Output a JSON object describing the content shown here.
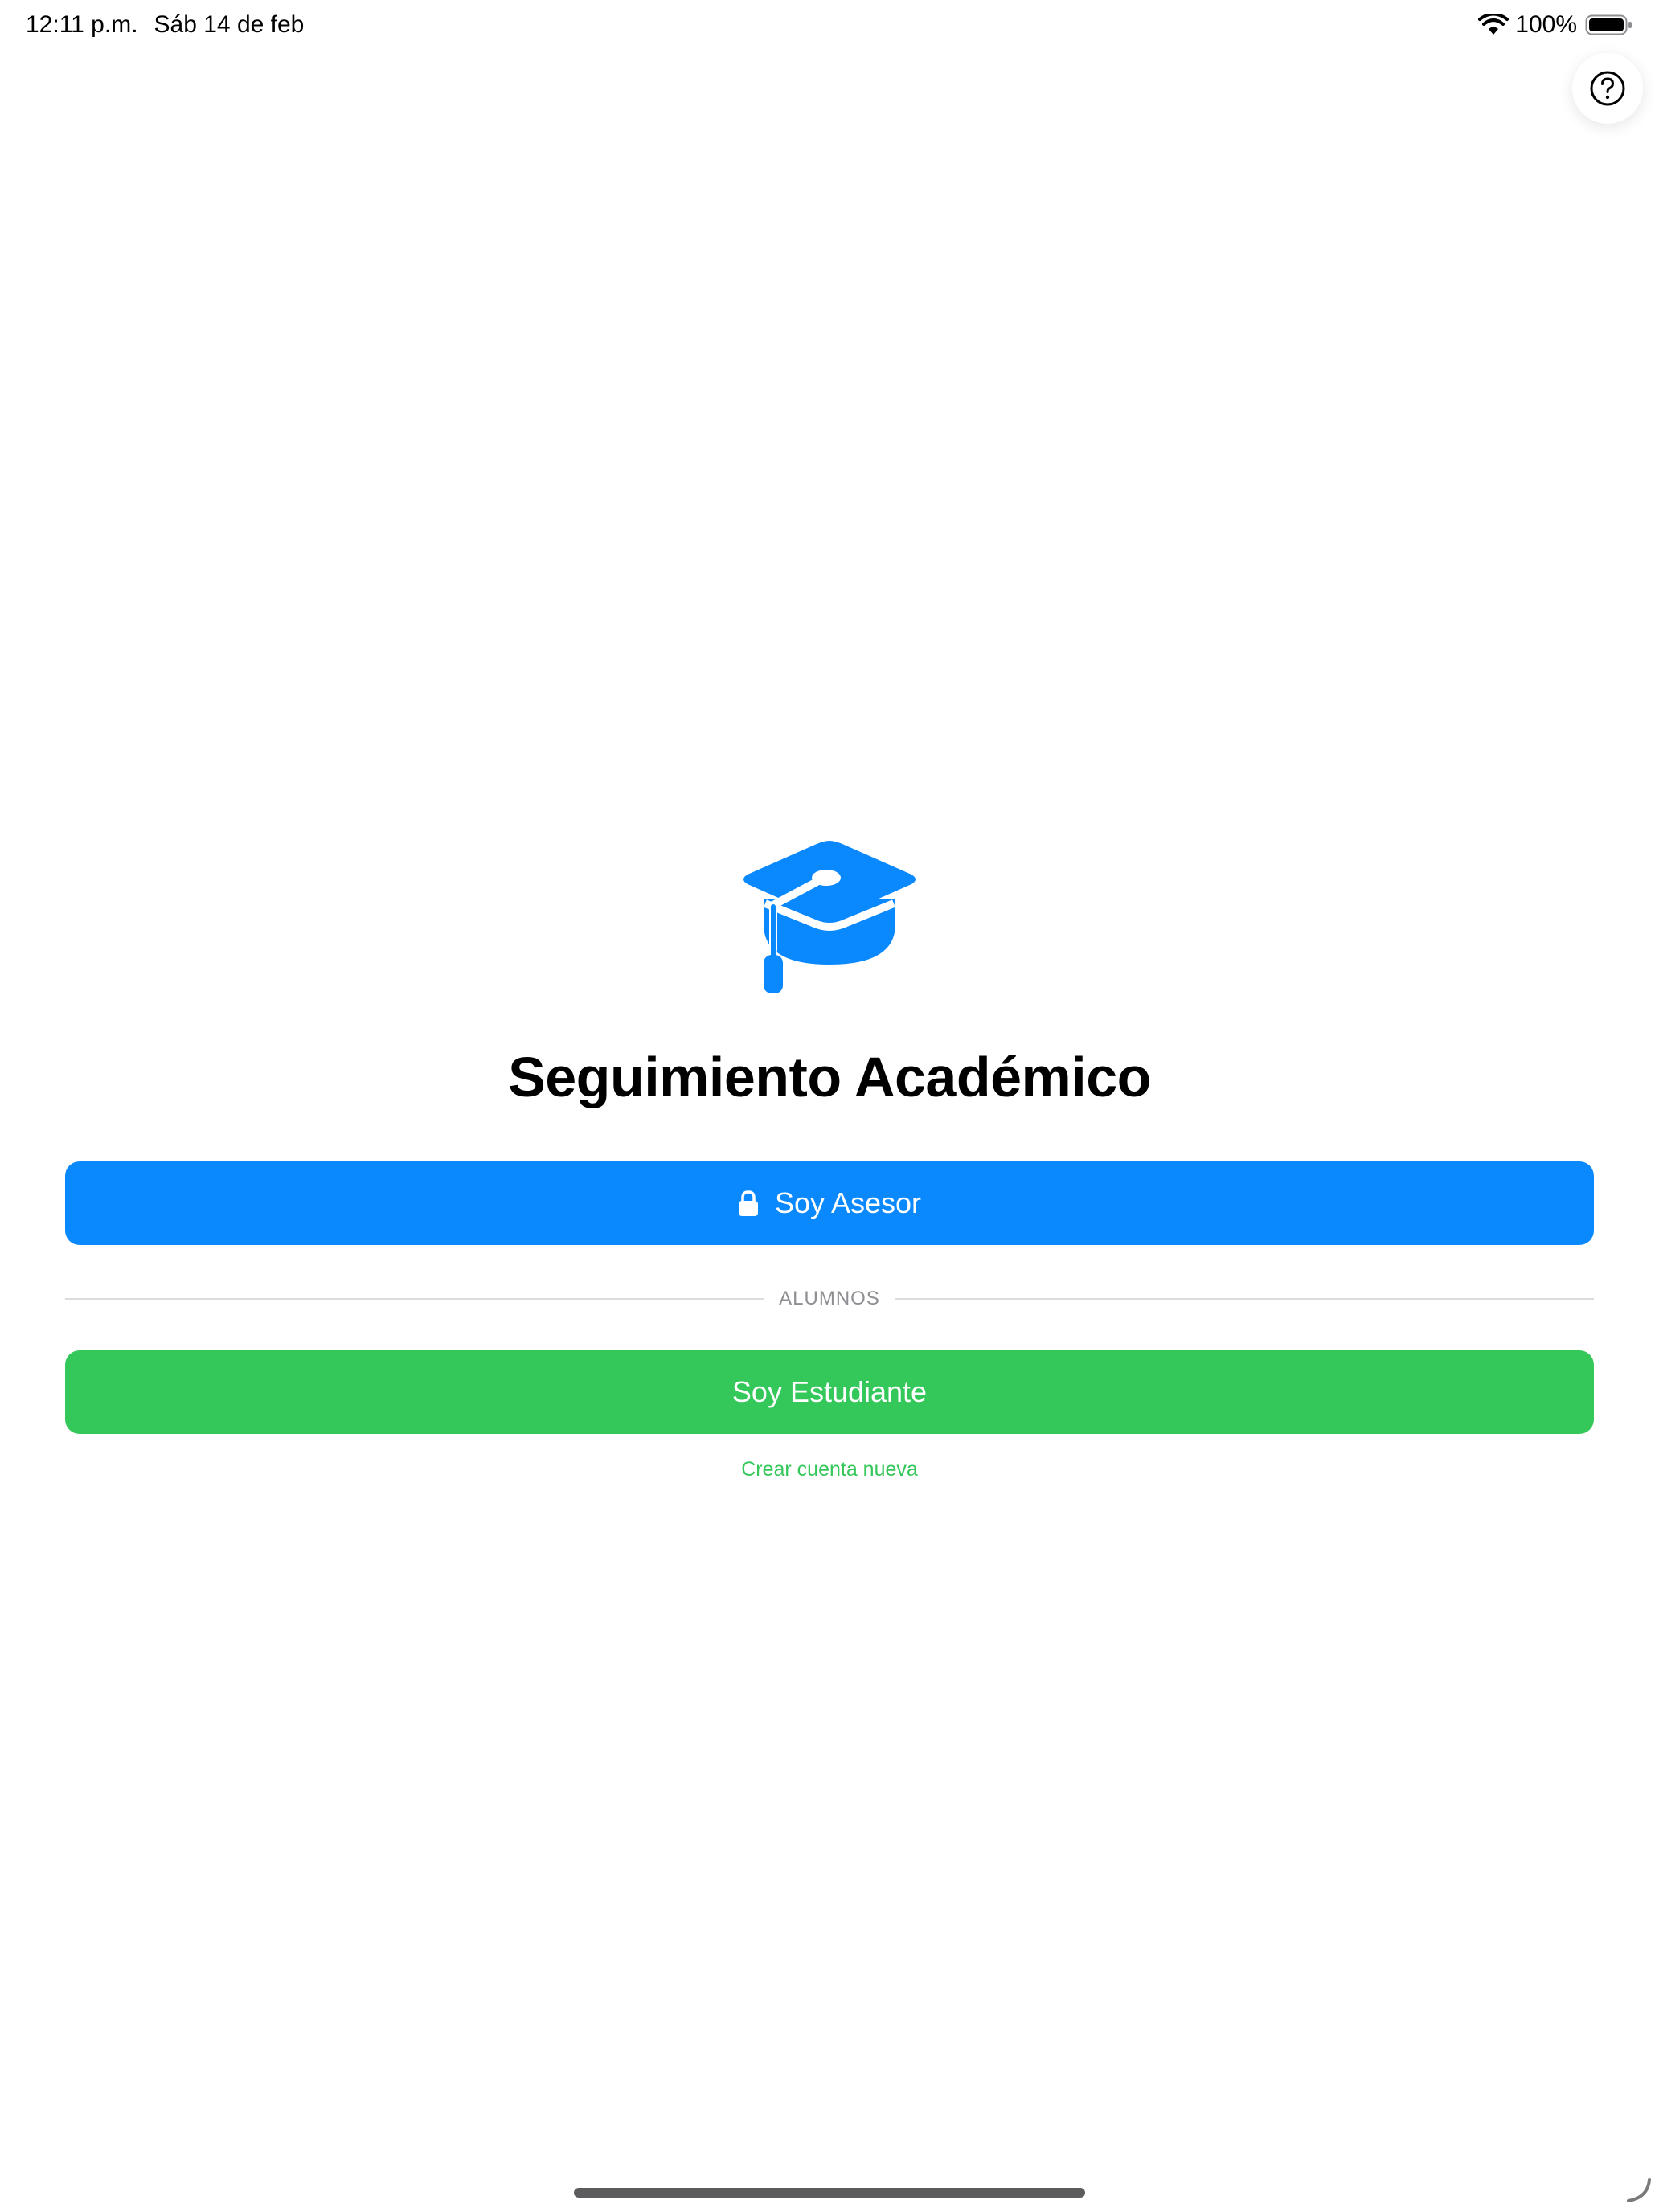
{
  "status_bar": {
    "time": "12:11 p.m.",
    "date": "Sáb 14 de feb",
    "battery": "100%",
    "icons": [
      "wifi-icon",
      "battery-icon"
    ]
  },
  "help": {
    "icon": "question-circle-icon"
  },
  "hero": {
    "icon": "graduation-cap-icon"
  },
  "title": "Seguimiento Académico",
  "asesor_button": {
    "label": "Soy Asesor",
    "icon": "lock-icon"
  },
  "divider_label": "ALUMNOS",
  "student_button": {
    "label": "Soy Estudiante"
  },
  "create_account": "Crear cuenta nueva",
  "colors": {
    "primary_blue": "#0a88fe",
    "success_green": "#34c759",
    "divider_gray": "#dcdcdc",
    "secondary_text": "#8e8e93"
  }
}
